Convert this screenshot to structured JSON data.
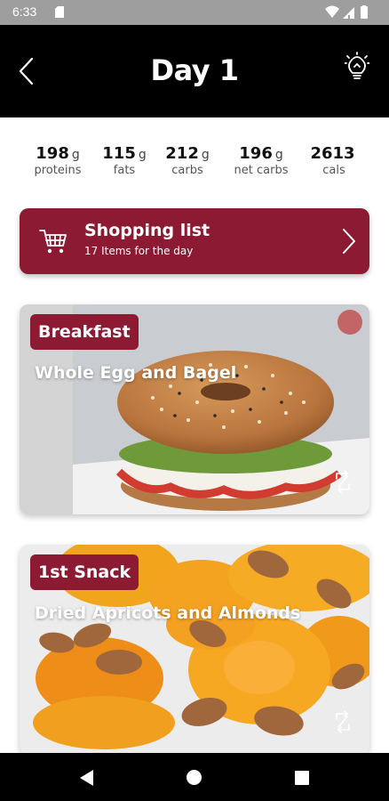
{
  "status_bar": {
    "time": "6:33"
  },
  "header": {
    "title": "Day 1"
  },
  "macros": [
    {
      "value": "198",
      "unit": "g",
      "label": "proteins"
    },
    {
      "value": "115",
      "unit": "g",
      "label": "fats"
    },
    {
      "value": "212",
      "unit": "g",
      "label": "carbs"
    },
    {
      "value": "196",
      "unit": "g",
      "label": "net carbs"
    },
    {
      "value": "2613",
      "unit": "",
      "label": "cals"
    }
  ],
  "shopping_list": {
    "title": "Shopping list",
    "subtitle": "17 Items for the day"
  },
  "meals": [
    {
      "badge": "Breakfast",
      "name": "Whole Egg and Bagel"
    },
    {
      "badge": "1st Snack",
      "name": "Dried Apricots and Almonds"
    }
  ],
  "colors": {
    "accent": "#8b1a32",
    "header_bg": "#000000",
    "status_bg": "#9e9e9e"
  },
  "icons": [
    "back-arrow-icon",
    "lightbulb-icon",
    "shopping-cart-icon",
    "chevron-right-icon",
    "swap-icon"
  ]
}
